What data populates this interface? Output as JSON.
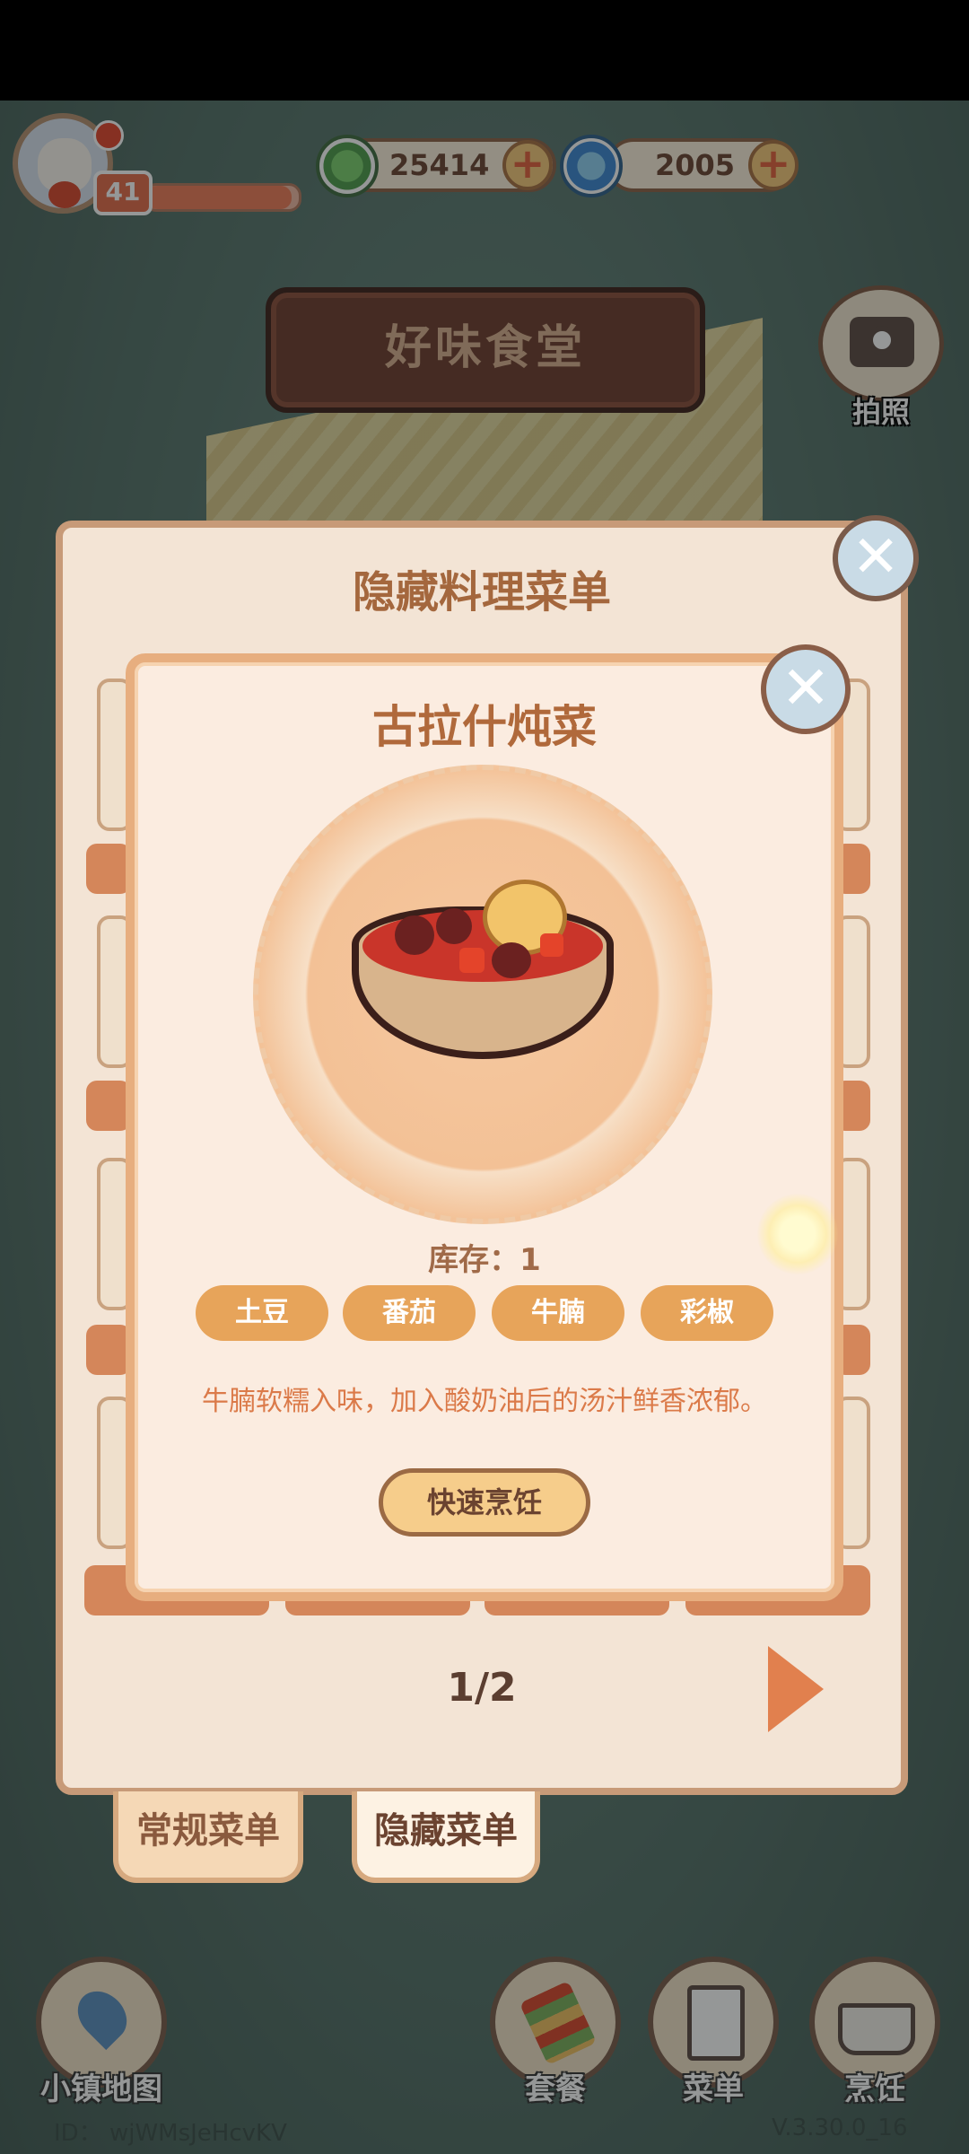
{
  "header": {
    "player_level": "41",
    "xp_progress": 0.95,
    "currency_leaf": "25414",
    "currency_swirl": "2005",
    "restaurant_title": "好味食堂",
    "camera_label": "拍照"
  },
  "menu_panel": {
    "title": "隐藏料理菜单",
    "page_indicator": "1/2",
    "tabs": [
      {
        "label": "常规菜单",
        "active": false
      },
      {
        "label": "隐藏菜单",
        "active": true
      }
    ]
  },
  "dish_popup": {
    "name": "古拉什炖菜",
    "stock_label": "库存：1",
    "ingredients": [
      "土豆",
      "番茄",
      "牛腩",
      "彩椒"
    ],
    "description": "牛腩软糯入味，加入酸奶油后的汤汁鲜香浓郁。",
    "cook_button": "快速烹饪"
  },
  "bottom_nav": {
    "map": "小镇地图",
    "combo": "套餐",
    "menu": "菜单",
    "cook": "烹饪"
  },
  "footer": {
    "id": "ID： wjWMsJeHcvKV",
    "version": "V.3.30.0_16"
  },
  "colors": {
    "accent_orange": "#e7a45a",
    "title_brown": "#b0693b",
    "panel_bg": "#f3e4d5"
  }
}
